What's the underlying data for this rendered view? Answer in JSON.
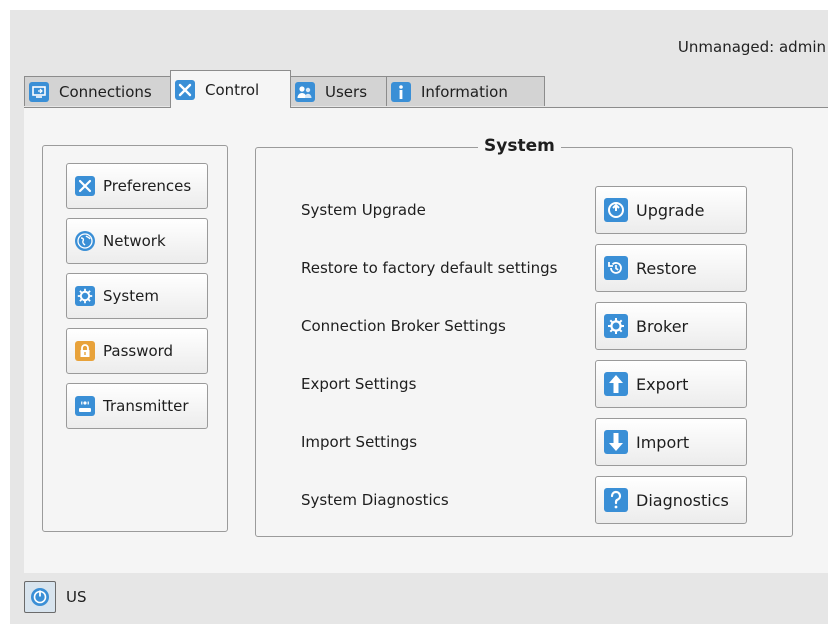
{
  "header": {
    "user_status": "Unmanaged: admin"
  },
  "tabs": [
    {
      "label": "Connections",
      "icon": "connections-icon",
      "active": false
    },
    {
      "label": "Control",
      "icon": "tools-icon",
      "active": true
    },
    {
      "label": "Users",
      "icon": "users-icon",
      "active": false
    },
    {
      "label": "Information",
      "icon": "info-icon",
      "active": false
    }
  ],
  "sidebar": {
    "items": [
      {
        "label": "Preferences",
        "icon": "tools-icon"
      },
      {
        "label": "Network",
        "icon": "globe-icon"
      },
      {
        "label": "System",
        "icon": "gear-icon"
      },
      {
        "label": "Password",
        "icon": "lock-icon"
      },
      {
        "label": "Transmitter",
        "icon": "transmitter-icon"
      }
    ]
  },
  "system": {
    "title": "System",
    "rows": [
      {
        "label": "System Upgrade",
        "button": "Upgrade",
        "icon": "upgrade-icon"
      },
      {
        "label": "Restore to factory default settings",
        "button": "Restore",
        "icon": "restore-icon"
      },
      {
        "label": "Connection Broker Settings",
        "button": "Broker",
        "icon": "gear-icon"
      },
      {
        "label": "Export Settings",
        "button": "Export",
        "icon": "arrow-up-icon"
      },
      {
        "label": "Import Settings",
        "button": "Import",
        "icon": "arrow-down-icon"
      },
      {
        "label": "System Diagnostics",
        "button": "Diagnostics",
        "icon": "question-icon"
      }
    ]
  },
  "status_bar": {
    "language": "US",
    "icon": "power-icon"
  },
  "colors": {
    "accent": "#3a8fd6",
    "background": "#e6e6e6",
    "panel": "#f5f5f5",
    "password_icon": "#e8a23a"
  }
}
